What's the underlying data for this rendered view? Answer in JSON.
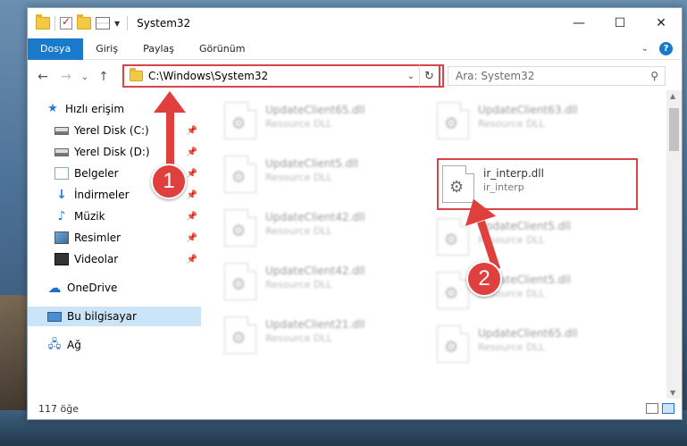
{
  "window": {
    "title": "System32",
    "minimize_icon": "—",
    "maximize_icon": "☐",
    "close_icon": "✕"
  },
  "ribbon": {
    "tabs": [
      "Dosya",
      "Giriş",
      "Paylaş",
      "Görünüm"
    ],
    "accent": "#1979ca",
    "help_label": "?"
  },
  "navigation": {
    "back_icon": "←",
    "forward_icon": "→",
    "recent_icon": "⌄",
    "up_icon": "↑",
    "address": "C:\\Windows\\System32",
    "search_placeholder": "Ara: System32"
  },
  "sidebar": {
    "items": [
      {
        "label": "Hızlı erişim",
        "icon": "star-icon"
      },
      {
        "label": "Yerel Disk (C:)",
        "icon": "drive-icon",
        "pinned": true
      },
      {
        "label": "Yerel Disk (D:)",
        "icon": "drive-icon",
        "pinned": true
      },
      {
        "label": "Belgeler",
        "icon": "documents-icon",
        "pinned": true
      },
      {
        "label": "İndirmeler",
        "icon": "download-icon",
        "pinned": true
      },
      {
        "label": "Müzik",
        "icon": "music-icon",
        "pinned": true
      },
      {
        "label": "Resimler",
        "icon": "pictures-icon",
        "pinned": true
      },
      {
        "label": "Videolar",
        "icon": "videos-icon",
        "pinned": true
      },
      {
        "label": "OneDrive",
        "icon": "onedrive-icon"
      },
      {
        "label": "Bu bilgisayar",
        "icon": "this-pc-icon",
        "selected": true
      },
      {
        "label": "Ağ",
        "icon": "network-icon"
      }
    ]
  },
  "files": [
    {
      "name": "UpdateClient65.dll",
      "type": "Resource DLL",
      "blurred": true
    },
    {
      "name": "UpdateClient63.dll",
      "type": "Resource DLL",
      "blurred": true
    },
    {
      "name": "UpdateClient5.dll",
      "type": "Resource DLL",
      "blurred": true
    },
    {
      "name": "ir_interp.dll",
      "type": "ir_interp",
      "blurred": false,
      "highlighted": true
    },
    {
      "name": "UpdateClient42.dll",
      "type": "Resource DLL",
      "blurred": true
    },
    {
      "name": "UpdateClient5.dll",
      "type": "Resource DLL",
      "blurred": true
    },
    {
      "name": "UpdateClient42.dll",
      "type": "Resource DLL",
      "blurred": true
    },
    {
      "name": "UpdateClient5.dll",
      "type": "Resource DLL",
      "blurred": true
    },
    {
      "name": "UpdateClient21.dll",
      "type": "Resource DLL",
      "blurred": true
    },
    {
      "name": "UpdateClient65.dll",
      "type": "Resource DLL",
      "blurred": true
    }
  ],
  "status": {
    "item_count": "117 öğe"
  },
  "annotations": {
    "badge_1": "1",
    "badge_2": "2",
    "color": "#e0403d"
  }
}
